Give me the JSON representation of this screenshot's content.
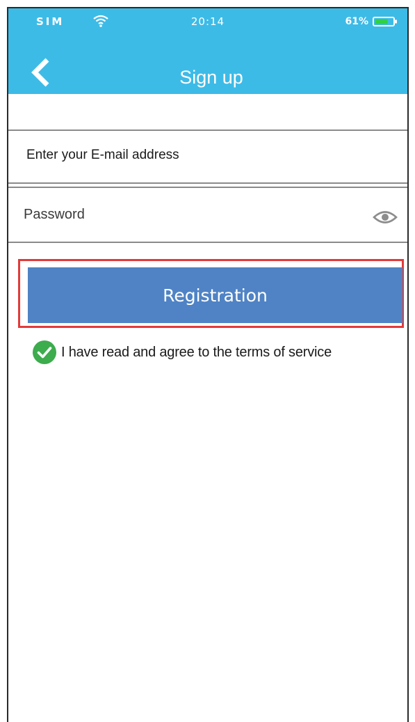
{
  "status_bar": {
    "carrier": "SIM",
    "time": "20:14",
    "battery": "61%"
  },
  "header": {
    "title": "Sign up",
    "back_icon": "chevron-left-icon",
    "background_color": "#3dbbe7"
  },
  "form": {
    "email_placeholder": "Enter your E-mail address",
    "password_placeholder": "Password",
    "visibility_icon": "eye-icon",
    "register_label": "Registration",
    "register_color": "#4f83c5",
    "highlight_color": "#e23a3a"
  },
  "terms": {
    "checked": true,
    "icon": "check-circle-icon",
    "check_color": "#3cac4c",
    "text": "I have read and agree to the terms of service"
  }
}
